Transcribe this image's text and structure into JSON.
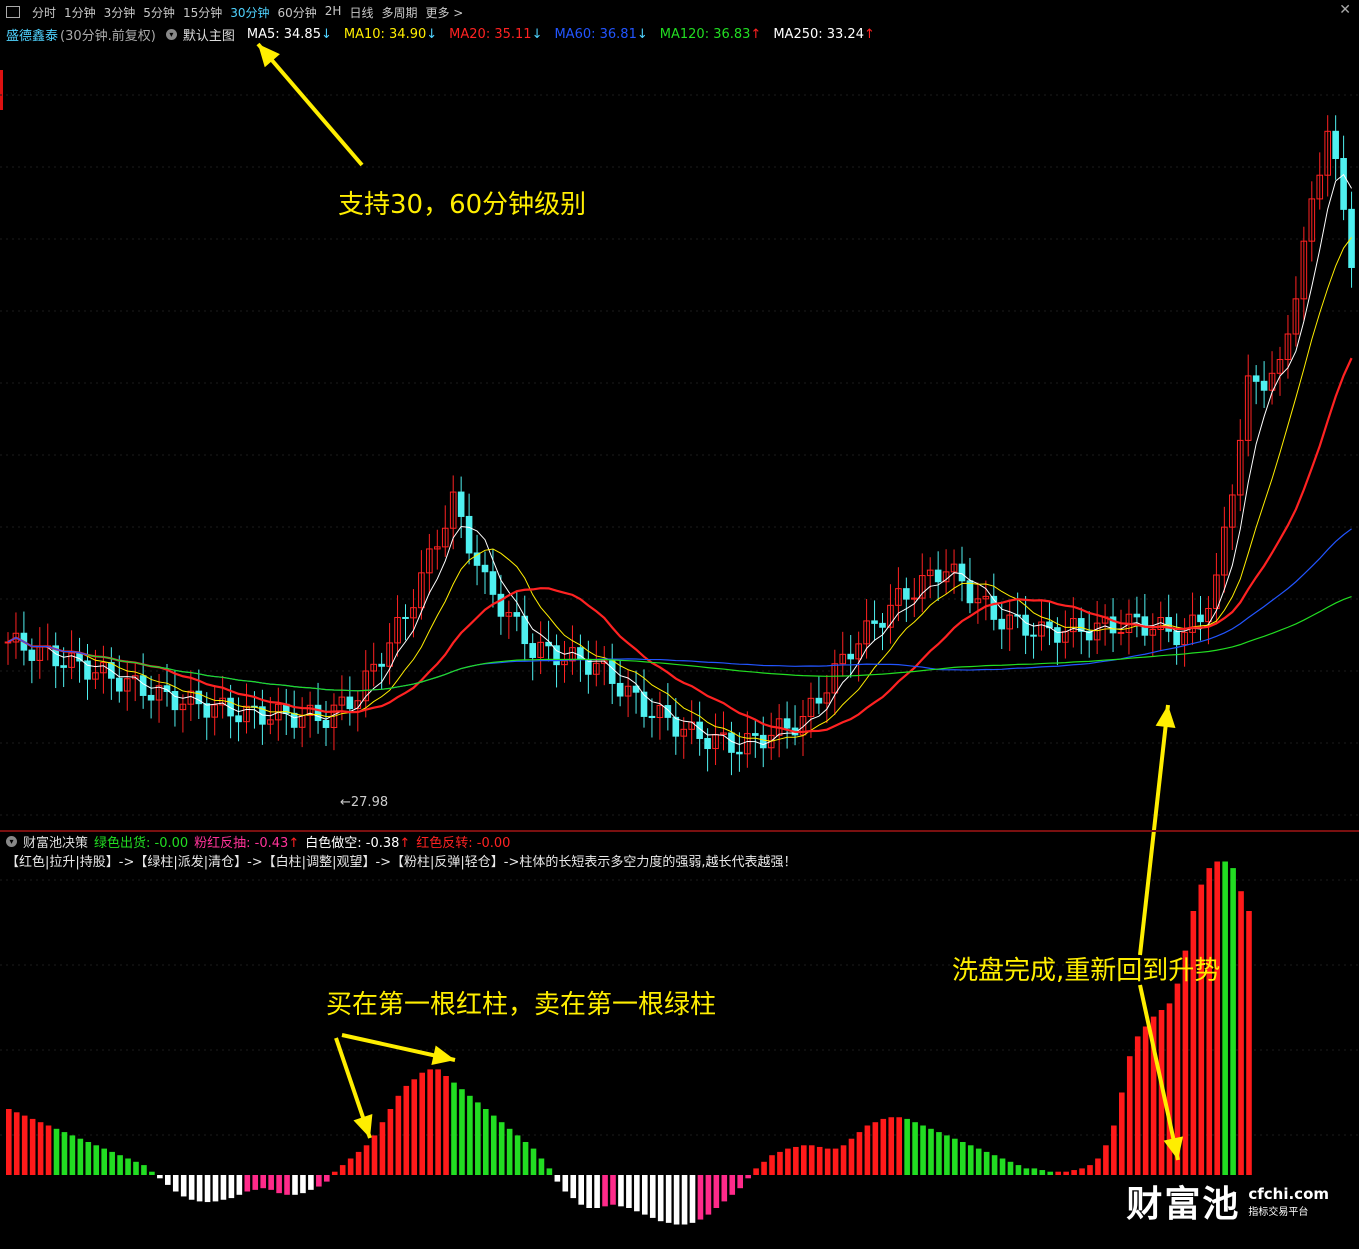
{
  "toolbar": {
    "tabs": [
      "分时",
      "1分钟",
      "3分钟",
      "5分钟",
      "15分钟",
      "30分钟",
      "60分钟",
      "2H",
      "日线",
      "多周期",
      "更多 >"
    ],
    "active_tab": "30分钟",
    "close_label": "✕"
  },
  "main_panel": {
    "stock_name": "盛德鑫泰",
    "period_note": "(30分钟.前复权)",
    "template_label": "默认主图",
    "indicators": [
      {
        "label": "MA5: 34.85",
        "arrow": "↓",
        "color": "#ffffff"
      },
      {
        "label": "MA10: 34.90",
        "arrow": "↓",
        "color": "#ffee00"
      },
      {
        "label": "MA20: 35.11",
        "arrow": "↓",
        "color": "#ff2222"
      },
      {
        "label": "MA60: 36.81",
        "arrow": "↓",
        "color": "#2255ff"
      },
      {
        "label": "MA120: 36.83",
        "arrow": "↑",
        "color": "#22dd22"
      },
      {
        "label": "MA250: 33.24",
        "arrow": "↑",
        "color": "#ffffff"
      }
    ],
    "low_label": "27.98"
  },
  "indicator_panel": {
    "title": "财富池决策",
    "values": [
      {
        "label": "绿色出货: -0.00",
        "color": "#22dd22"
      },
      {
        "label": "粉红反抽: -0.43",
        "arrow": "↑",
        "color": "#ff3399"
      },
      {
        "label": "白色做空: -0.38",
        "arrow": "↑",
        "color": "#ffffff"
      },
      {
        "label": "红色反转: -0.00",
        "color": "#ff2222"
      }
    ],
    "description": "【红色|拉升|持股】->【绿柱|派发|清仓】->【白柱|调整|观望】->【粉柱|反弹|轻仓】->柱体的长短表示多空力度的强弱,越长代表越强！"
  },
  "annotations": {
    "support": "支持30，60分钟级别",
    "buy_sell": "买在第一根红柱，卖在第一根绿柱",
    "washout": "洗盘完成,重新回到升势"
  },
  "brand": {
    "name": "财富池",
    "url": "cfchi.com",
    "tagline": "指标交易平台"
  },
  "colors": {
    "up": "#ff2222",
    "down": "#4ff0f0",
    "annotation": "#ffee00",
    "ma5": "#ffffff",
    "ma10": "#ffee00",
    "ma20": "#ff2222",
    "ma60": "#2255ff",
    "ma120": "#22dd22"
  },
  "chart_data": {
    "type": "bar",
    "series": [
      {
        "name": "MA5",
        "last": 34.85
      },
      {
        "name": "MA10",
        "last": 34.9
      },
      {
        "name": "MA20",
        "last": 35.11
      },
      {
        "name": "MA60",
        "last": 36.81
      },
      {
        "name": "MA120",
        "last": 36.83
      },
      {
        "name": "MA250",
        "last": 33.24
      }
    ],
    "price_low": 27.98,
    "histogram": {
      "values": [
        2.0,
        1.9,
        1.8,
        1.7,
        1.6,
        1.5,
        1.4,
        1.3,
        1.2,
        1.1,
        1.0,
        0.9,
        0.8,
        0.7,
        0.6,
        0.5,
        0.4,
        0.3,
        0.1,
        -0.1,
        -0.3,
        -0.5,
        -0.65,
        -0.75,
        -0.8,
        -0.82,
        -0.8,
        -0.75,
        -0.7,
        -0.6,
        -0.5,
        -0.45,
        -0.4,
        -0.45,
        -0.55,
        -0.6,
        -0.6,
        -0.55,
        -0.45,
        -0.35,
        -0.2,
        0.1,
        0.3,
        0.5,
        0.7,
        0.9,
        1.2,
        1.6,
        2.0,
        2.4,
        2.7,
        2.9,
        3.1,
        3.2,
        3.2,
        3.0,
        2.8,
        2.6,
        2.4,
        2.2,
        2.0,
        1.8,
        1.6,
        1.4,
        1.2,
        1.0,
        0.8,
        0.5,
        0.2,
        -0.2,
        -0.5,
        -0.7,
        -0.9,
        -1.0,
        -1.0,
        -0.95,
        -0.9,
        -0.95,
        -1.0,
        -1.1,
        -1.2,
        -1.3,
        -1.4,
        -1.45,
        -1.5,
        -1.5,
        -1.45,
        -1.35,
        -1.2,
        -1.0,
        -0.8,
        -0.6,
        -0.4,
        -0.1,
        0.2,
        0.4,
        0.6,
        0.7,
        0.8,
        0.85,
        0.9,
        0.9,
        0.85,
        0.8,
        0.8,
        0.9,
        1.1,
        1.3,
        1.5,
        1.6,
        1.7,
        1.75,
        1.75,
        1.7,
        1.6,
        1.5,
        1.4,
        1.3,
        1.2,
        1.1,
        1.0,
        0.9,
        0.8,
        0.7,
        0.6,
        0.5,
        0.4,
        0.3,
        0.2,
        0.2,
        0.15,
        0.1,
        0.1,
        0.1,
        0.15,
        0.2,
        0.3,
        0.5,
        0.9,
        1.5,
        2.5,
        3.6,
        4.2,
        4.5,
        4.8,
        5.0,
        5.2,
        5.8,
        6.8,
        8.0,
        8.8,
        9.3,
        9.5,
        9.5,
        9.3,
        8.6,
        8.0
      ],
      "colors": [
        "r",
        "r",
        "r",
        "r",
        "r",
        "r",
        "g",
        "g",
        "g",
        "g",
        "g",
        "g",
        "g",
        "g",
        "g",
        "g",
        "g",
        "g",
        "g",
        "w",
        "w",
        "w",
        "w",
        "w",
        "w",
        "w",
        "w",
        "w",
        "w",
        "w",
        "p",
        "p",
        "p",
        "p",
        "p",
        "p",
        "w",
        "w",
        "w",
        "p",
        "p",
        "r",
        "r",
        "r",
        "r",
        "r",
        "r",
        "r",
        "r",
        "r",
        "r",
        "r",
        "r",
        "r",
        "r",
        "r",
        "g",
        "g",
        "g",
        "g",
        "g",
        "g",
        "g",
        "g",
        "g",
        "g",
        "g",
        "g",
        "g",
        "w",
        "w",
        "w",
        "w",
        "w",
        "w",
        "p",
        "p",
        "w",
        "w",
        "w",
        "w",
        "w",
        "w",
        "w",
        "w",
        "w",
        "w",
        "p",
        "p",
        "p",
        "p",
        "p",
        "p",
        "p",
        "r",
        "r",
        "r",
        "r",
        "r",
        "r",
        "r",
        "r",
        "r",
        "r",
        "r",
        "r",
        "r",
        "r",
        "r",
        "r",
        "r",
        "r",
        "r",
        "g",
        "g",
        "g",
        "g",
        "g",
        "g",
        "g",
        "g",
        "g",
        "g",
        "g",
        "g",
        "g",
        "g",
        "g",
        "g",
        "g",
        "g",
        "g",
        "r",
        "r",
        "r",
        "r",
        "r",
        "r",
        "r",
        "r",
        "r",
        "r",
        "r",
        "r",
        "r",
        "r",
        "r",
        "r",
        "r",
        "r",
        "r",
        "r",
        "r",
        "g",
        "g"
      ]
    }
  }
}
